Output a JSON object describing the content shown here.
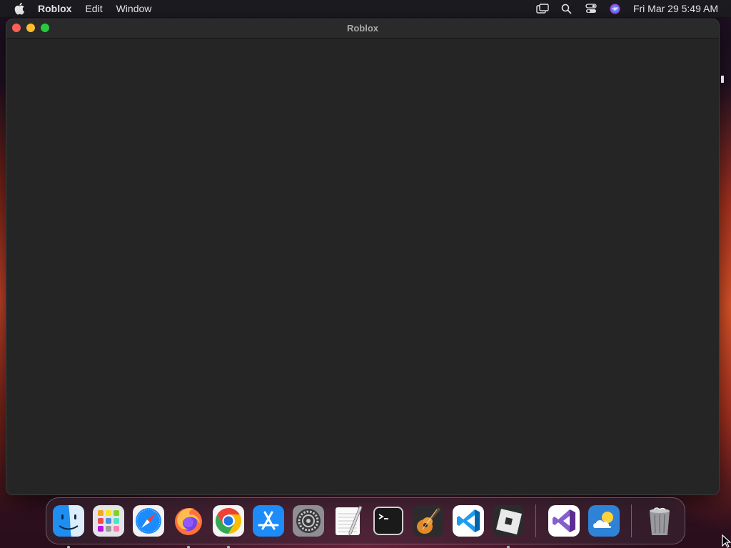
{
  "menubar": {
    "app_name": "Roblox",
    "items": [
      "Edit",
      "Window"
    ],
    "clock": "Fri Mar 29  5:49 AM",
    "status_icons": [
      "screen-mirroring-icon",
      "spotlight-search-icon",
      "control-center-icon",
      "siri-icon"
    ]
  },
  "window": {
    "title": "Roblox",
    "content_background": "#252525"
  },
  "dock": {
    "apps": [
      {
        "name": "Finder",
        "icon": "finder-icon",
        "running": true
      },
      {
        "name": "Launchpad",
        "icon": "launchpad-icon",
        "running": false
      },
      {
        "name": "Safari",
        "icon": "safari-icon",
        "running": false
      },
      {
        "name": "Firefox",
        "icon": "firefox-icon",
        "running": true
      },
      {
        "name": "Google Chrome",
        "icon": "chrome-icon",
        "running": true
      },
      {
        "name": "App Store",
        "icon": "app-store-icon",
        "running": false
      },
      {
        "name": "System Settings",
        "icon": "system-settings-icon",
        "running": false
      },
      {
        "name": "TextEdit",
        "icon": "textedit-icon",
        "running": false
      },
      {
        "name": "Terminal",
        "icon": "terminal-icon",
        "running": false
      },
      {
        "name": "GarageBand",
        "icon": "garageband-icon",
        "running": false
      },
      {
        "name": "Visual Studio Code",
        "icon": "vscode-icon",
        "running": false
      },
      {
        "name": "Roblox",
        "icon": "roblox-icon",
        "running": true
      }
    ],
    "recent_apps": [
      {
        "name": "Visual Studio",
        "icon": "visual-studio-icon"
      },
      {
        "name": "Weather",
        "icon": "weather-icon"
      }
    ],
    "trash": {
      "name": "Trash",
      "icon": "trash-icon"
    }
  },
  "colors": {
    "close": "#fe5f57",
    "minimize": "#febc2e",
    "maximize": "#28c840"
  }
}
